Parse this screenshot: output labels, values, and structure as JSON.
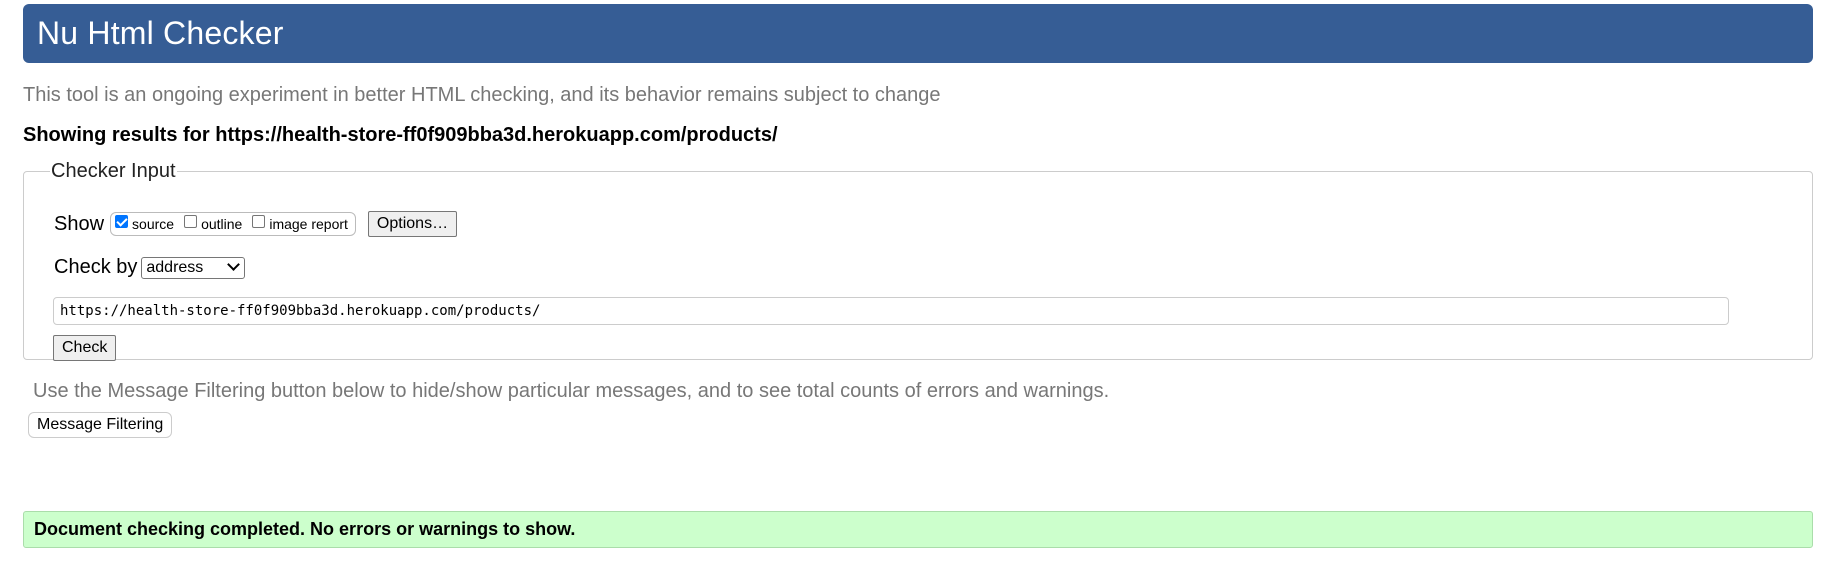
{
  "header": {
    "title": "Nu Html Checker"
  },
  "intro": {
    "text": "This tool is an ongoing experiment in better HTML checking, and its behavior remains subject to change"
  },
  "results": {
    "heading": "Showing results for https://health-store-ff0f909bba3d.herokuapp.com/products/"
  },
  "checker_input": {
    "legend": "Checker Input",
    "show_label": "Show",
    "show_options": [
      {
        "label": "source",
        "checked": true
      },
      {
        "label": "outline",
        "checked": false
      },
      {
        "label": "image report",
        "checked": false
      }
    ],
    "options_button": "Options…",
    "check_by_label": "Check by",
    "check_by_selected": "address",
    "url_value": "https://health-store-ff0f909bba3d.herokuapp.com/products/",
    "check_button": "Check"
  },
  "filtering": {
    "note": "Use the Message Filtering button below to hide/show particular messages, and to see total counts of errors and warnings.",
    "button": "Message Filtering"
  },
  "status": {
    "message": "Document checking completed. No errors or warnings to show."
  },
  "colors": {
    "header_bg": "#365d95",
    "success_bg": "#ccffcc",
    "muted_text": "#777777"
  }
}
